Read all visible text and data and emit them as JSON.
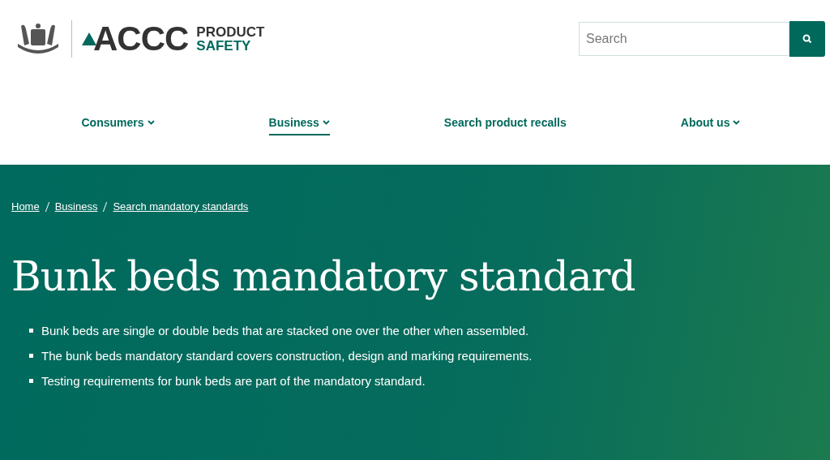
{
  "logo": {
    "mark": "ACCC",
    "line_1": "PRODUCT",
    "line_2": "SAFETY"
  },
  "search": {
    "placeholder": "Search"
  },
  "nav": [
    {
      "label": "Consumers",
      "dropdown": true,
      "selected": false
    },
    {
      "label": "Business",
      "dropdown": true,
      "selected": true
    },
    {
      "label": "Search product recalls",
      "dropdown": false,
      "selected": false
    },
    {
      "label": "About us",
      "dropdown": true,
      "selected": false
    }
  ],
  "breadcrumbs": [
    "Home",
    "Business",
    "Search mandatory standards"
  ],
  "title": "Bunk beds mandatory standard",
  "bullets": [
    "Bunk beds are single or double beds that are stacked one over the other when assembled.",
    "The bunk beds mandatory standard covers construction, design and marking requirements.",
    "Testing requirements for bunk beds are part of the mandatory standard."
  ]
}
